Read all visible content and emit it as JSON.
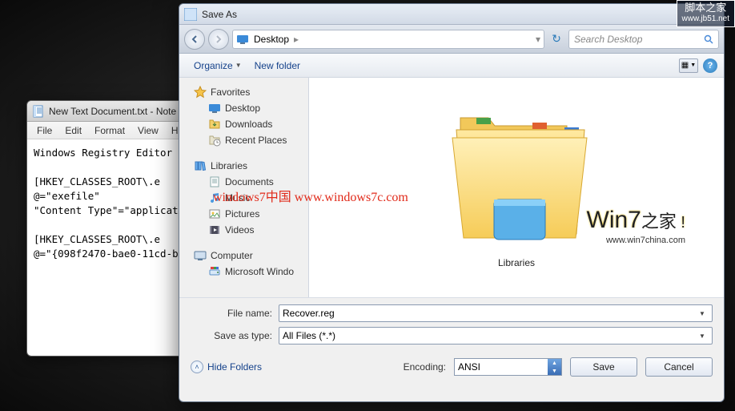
{
  "notepad": {
    "title": "New Text Document.txt - Note",
    "menu": [
      "File",
      "Edit",
      "Format",
      "View",
      "H"
    ],
    "body": "Windows Registry Editor Ve\n\n[HKEY_CLASSES_ROOT\\.e\n@=\"exefile\"\n\"Content Type\"=\"application\n\n[HKEY_CLASSES_ROOT\\.e\n@=\"{098f2470-bae0-11cd-b"
  },
  "saveas": {
    "title": "Save As",
    "nav": {
      "location": "Desktop",
      "search_placeholder": "Search Desktop"
    },
    "toolbar": {
      "organize": "Organize",
      "new_folder": "New folder"
    },
    "tree": {
      "favorites": {
        "label": "Favorites",
        "items": [
          "Desktop",
          "Downloads",
          "Recent Places"
        ]
      },
      "libraries": {
        "label": "Libraries",
        "items": [
          "Documents",
          "Music",
          "Pictures",
          "Videos"
        ]
      },
      "computer": {
        "label": "Computer",
        "items": [
          "Microsoft Windo"
        ]
      }
    },
    "content_item": "Libraries",
    "file_name_label": "File name:",
    "file_name_value": "Recover.reg",
    "save_type_label": "Save as type:",
    "save_type_value": "All Files  (*.*)",
    "hide_folders": "Hide Folders",
    "encoding_label": "Encoding:",
    "encoding_value": "ANSI",
    "save_btn": "Save",
    "cancel_btn": "Cancel"
  },
  "overlay": {
    "red": "windows7中国  www.windows7c.com",
    "win7": "Win7",
    "win7_cn": "之家",
    "win7_url": "www.win7china.com",
    "corner1": "脚本之家",
    "corner2": "www.jb51.net"
  }
}
